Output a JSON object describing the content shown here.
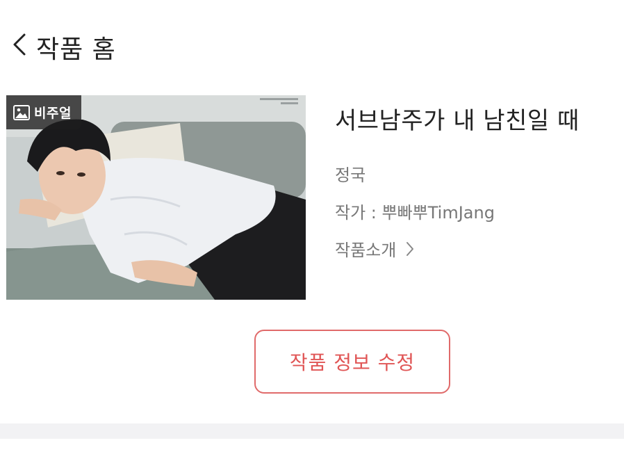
{
  "header": {
    "back_icon": "chevron-left-icon",
    "title": "작품 홈"
  },
  "cover": {
    "badge_icon": "image-icon",
    "badge_label": "비주얼"
  },
  "work": {
    "title": "서브남주가 내 남친일 때",
    "tag": "정국",
    "author": "작가 : 뿌빠뿌TimJang",
    "intro_label": "작품소개",
    "intro_icon": "chevron-right-icon"
  },
  "actions": {
    "edit_label": "작품 정보 수정"
  },
  "colors": {
    "accent": "#e05555",
    "text_primary": "#222222",
    "text_secondary": "#777777",
    "divider": "#f2f2f4"
  }
}
